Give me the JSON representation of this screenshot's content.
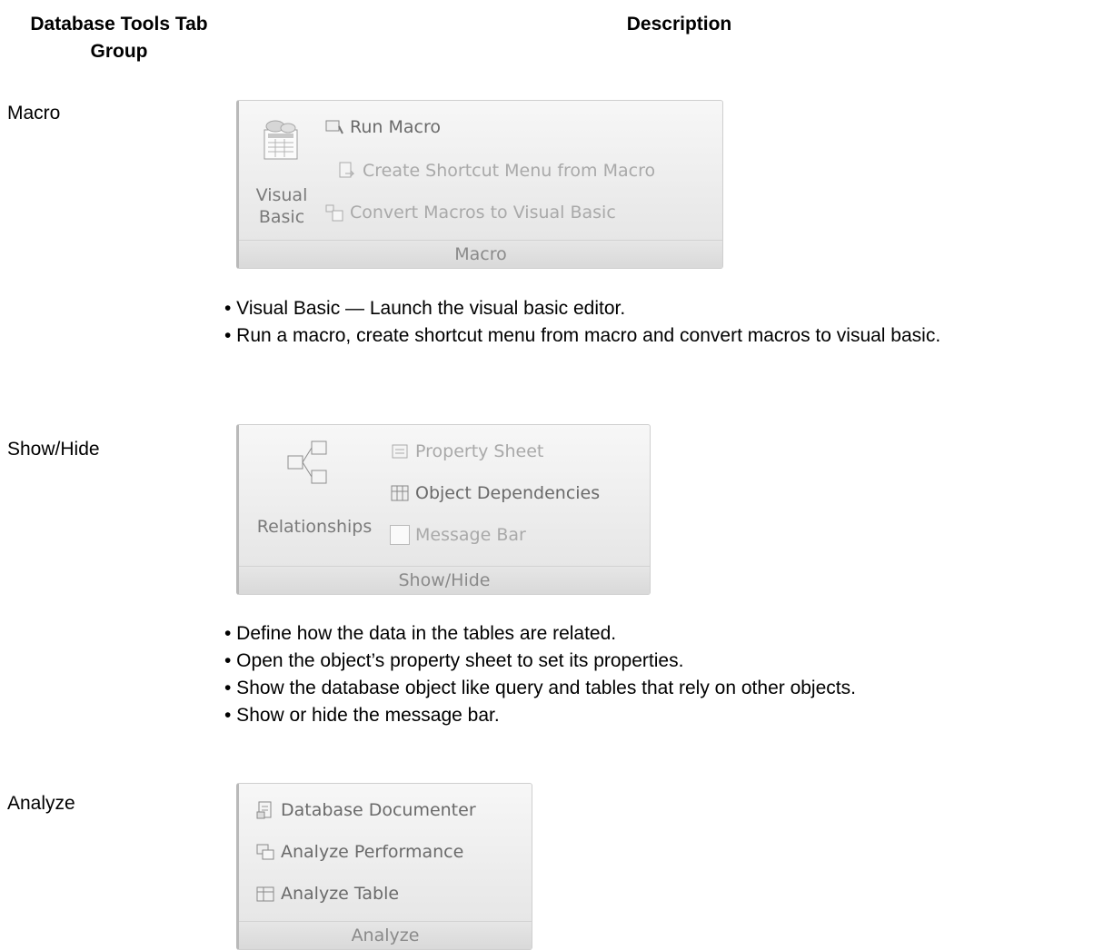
{
  "header": {
    "col1": "Database Tools Tab Group",
    "col2": "Description"
  },
  "rows": [
    {
      "label": "Macro",
      "ribbon": {
        "big_button": "Visual Basic",
        "items": [
          "Run Macro",
          "Create Shortcut Menu from Macro",
          "Convert Macros to Visual Basic"
        ],
        "group_label": "Macro"
      },
      "bullets": [
        "• Visual Basic — Launch the visual basic editor.",
        "• Run a macro, create shortcut menu from macro and convert macros to visual basic."
      ]
    },
    {
      "label": "Show/Hide",
      "ribbon": {
        "big_button": "Relationships",
        "items": [
          "Property Sheet",
          "Object Dependencies",
          "Message Bar"
        ],
        "group_label": "Show/Hide"
      },
      "bullets": [
        "• Define how the data in the tables are related.",
        "• Open the object’s property sheet to set its properties.",
        "• Show the database object like query and tables that rely on other objects.",
        "• Show or hide the message bar."
      ]
    },
    {
      "label": "Analyze",
      "ribbon": {
        "items": [
          "Database Documenter",
          "Analyze Performance",
          "Analyze Table"
        ],
        "group_label": "Analyze"
      }
    }
  ]
}
